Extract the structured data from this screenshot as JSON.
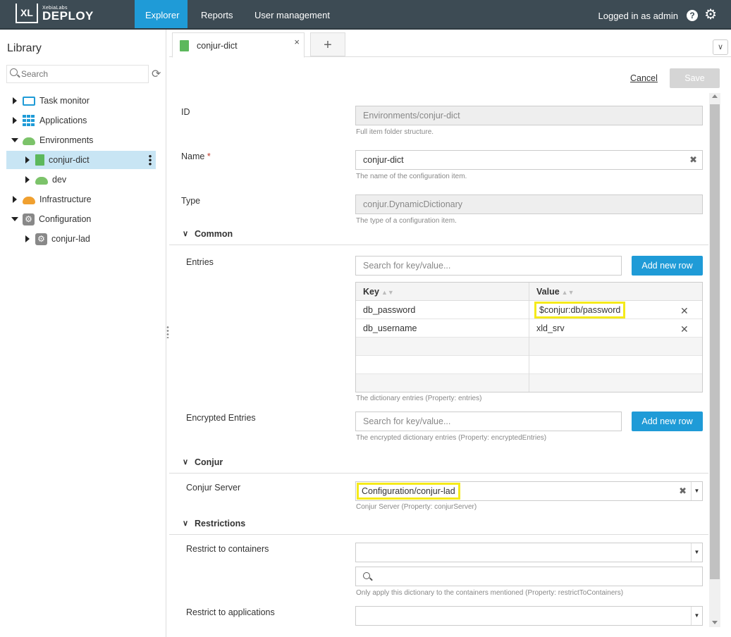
{
  "header": {
    "logo_mark": "XL",
    "logo_small": "XebiaLabs",
    "logo_name": "DEPLOY",
    "nav": [
      "Explorer",
      "Reports",
      "User management"
    ],
    "login_text": "Logged in as admin",
    "help_glyph": "?"
  },
  "sidebar": {
    "title": "Library",
    "search_placeholder": "Search",
    "items": [
      {
        "label": "Task monitor",
        "icon": "monitor-icon"
      },
      {
        "label": "Applications",
        "icon": "grid-icon"
      },
      {
        "label": "Environments",
        "icon": "cloud-icon"
      },
      {
        "label": "conjur-dict",
        "icon": "dictionary-icon"
      },
      {
        "label": "dev",
        "icon": "cloud-icon"
      },
      {
        "label": "Infrastructure",
        "icon": "infrastructure-icon"
      },
      {
        "label": "Configuration",
        "icon": "gear-icon"
      },
      {
        "label": "conjur-lad",
        "icon": "gear-icon"
      }
    ]
  },
  "tabs": {
    "active_label": "conjur-dict",
    "close_glyph": "×",
    "add_glyph": "+",
    "menu_glyph": "∨"
  },
  "form": {
    "cancel_label": "Cancel",
    "save_label": "Save",
    "id": {
      "label": "ID",
      "value": "Environments/conjur-dict",
      "help": "Full item folder structure."
    },
    "name": {
      "label": "Name",
      "required_mark": "*",
      "value": "conjur-dict",
      "help": "The name of the configuration item."
    },
    "type": {
      "label": "Type",
      "value": "conjur.DynamicDictionary",
      "help": "The type of a configuration item."
    },
    "sections": {
      "common": "Common",
      "conjur": "Conjur",
      "restrictions": "Restrictions"
    },
    "entries": {
      "label": "Entries",
      "search_placeholder": "Search for key/value...",
      "add_label": "Add new row",
      "columns": [
        "Key",
        "Value"
      ],
      "rows": [
        {
          "key": "db_password",
          "value": "$conjur:db/password"
        },
        {
          "key": "db_username",
          "value": "xld_srv"
        }
      ],
      "help": "The dictionary entries (Property: entries)"
    },
    "encrypted_entries": {
      "label": "Encrypted Entries",
      "search_placeholder": "Search for key/value...",
      "add_label": "Add new row",
      "help": "The encrypted dictionary entries (Property: encryptedEntries)"
    },
    "conjur_server": {
      "label": "Conjur Server",
      "value": "Configuration/conjur-lad",
      "help": "Conjur Server (Property: conjurServer)"
    },
    "restrict_containers": {
      "label": "Restrict to containers",
      "help": "Only apply this dictionary to the containers mentioned (Property: restrictToContainers)"
    },
    "restrict_applications": {
      "label": "Restrict to applications"
    }
  },
  "colors": {
    "topbar": "#3d4b54",
    "accent": "#1f9bd7",
    "highlight": "#f5ea1a"
  }
}
